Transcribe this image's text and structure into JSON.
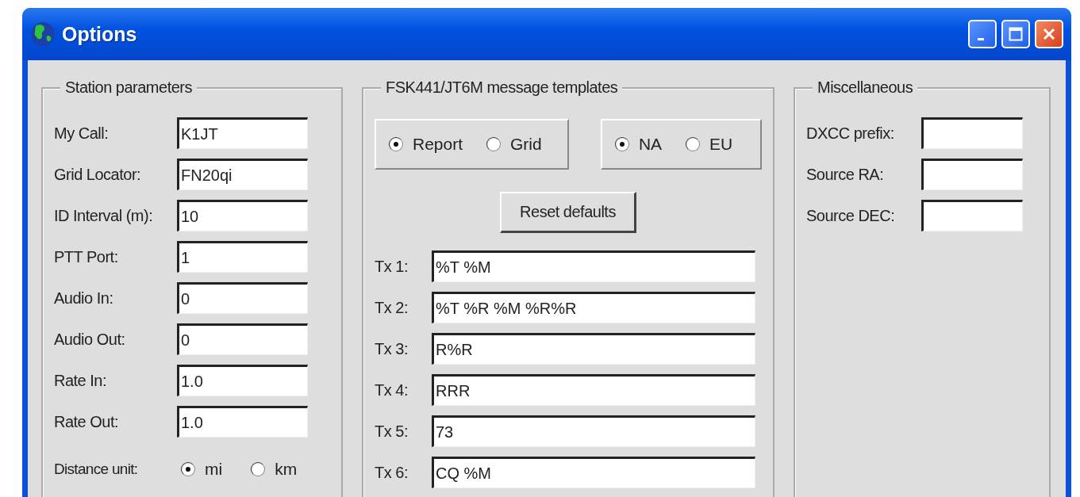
{
  "window": {
    "title": "Options"
  },
  "station": {
    "title": "Station parameters",
    "fields": [
      {
        "label": "My Call:",
        "value": "K1JT"
      },
      {
        "label": "Grid Locator:",
        "value": "FN20qi"
      },
      {
        "label": "ID Interval (m):",
        "value": "10"
      },
      {
        "label": "PTT Port:",
        "value": "1"
      },
      {
        "label": "Audio In:",
        "value": "0"
      },
      {
        "label": "Audio Out:",
        "value": "0"
      },
      {
        "label": "Rate In:",
        "value": "1.0"
      },
      {
        "label": "Rate Out:",
        "value": "1.0"
      }
    ],
    "distance": {
      "label": "Distance unit:",
      "options": [
        {
          "label": "mi",
          "selected": true
        },
        {
          "label": "km",
          "selected": false
        }
      ]
    }
  },
  "templates": {
    "title": "FSK441/JT6M message templates",
    "mode_options": [
      {
        "label": "Report",
        "selected": true
      },
      {
        "label": "Grid",
        "selected": false
      }
    ],
    "region_options": [
      {
        "label": "NA",
        "selected": true
      },
      {
        "label": "EU",
        "selected": false
      }
    ],
    "reset_button": "Reset defaults",
    "messages": [
      {
        "label": "Tx 1:",
        "value": "%T %M"
      },
      {
        "label": "Tx 2:",
        "value": "%T %R %M %R%R"
      },
      {
        "label": "Tx 3:",
        "value": "R%R"
      },
      {
        "label": "Tx 4:",
        "value": "RRR"
      },
      {
        "label": "Tx 5:",
        "value": "73"
      },
      {
        "label": "Tx 6:",
        "value": "CQ %M"
      }
    ]
  },
  "misc": {
    "title": "Miscellaneous",
    "fields": [
      {
        "label": "DXCC prefix:"
      },
      {
        "label": "Source RA:"
      },
      {
        "label": "Source DEC:"
      }
    ]
  }
}
